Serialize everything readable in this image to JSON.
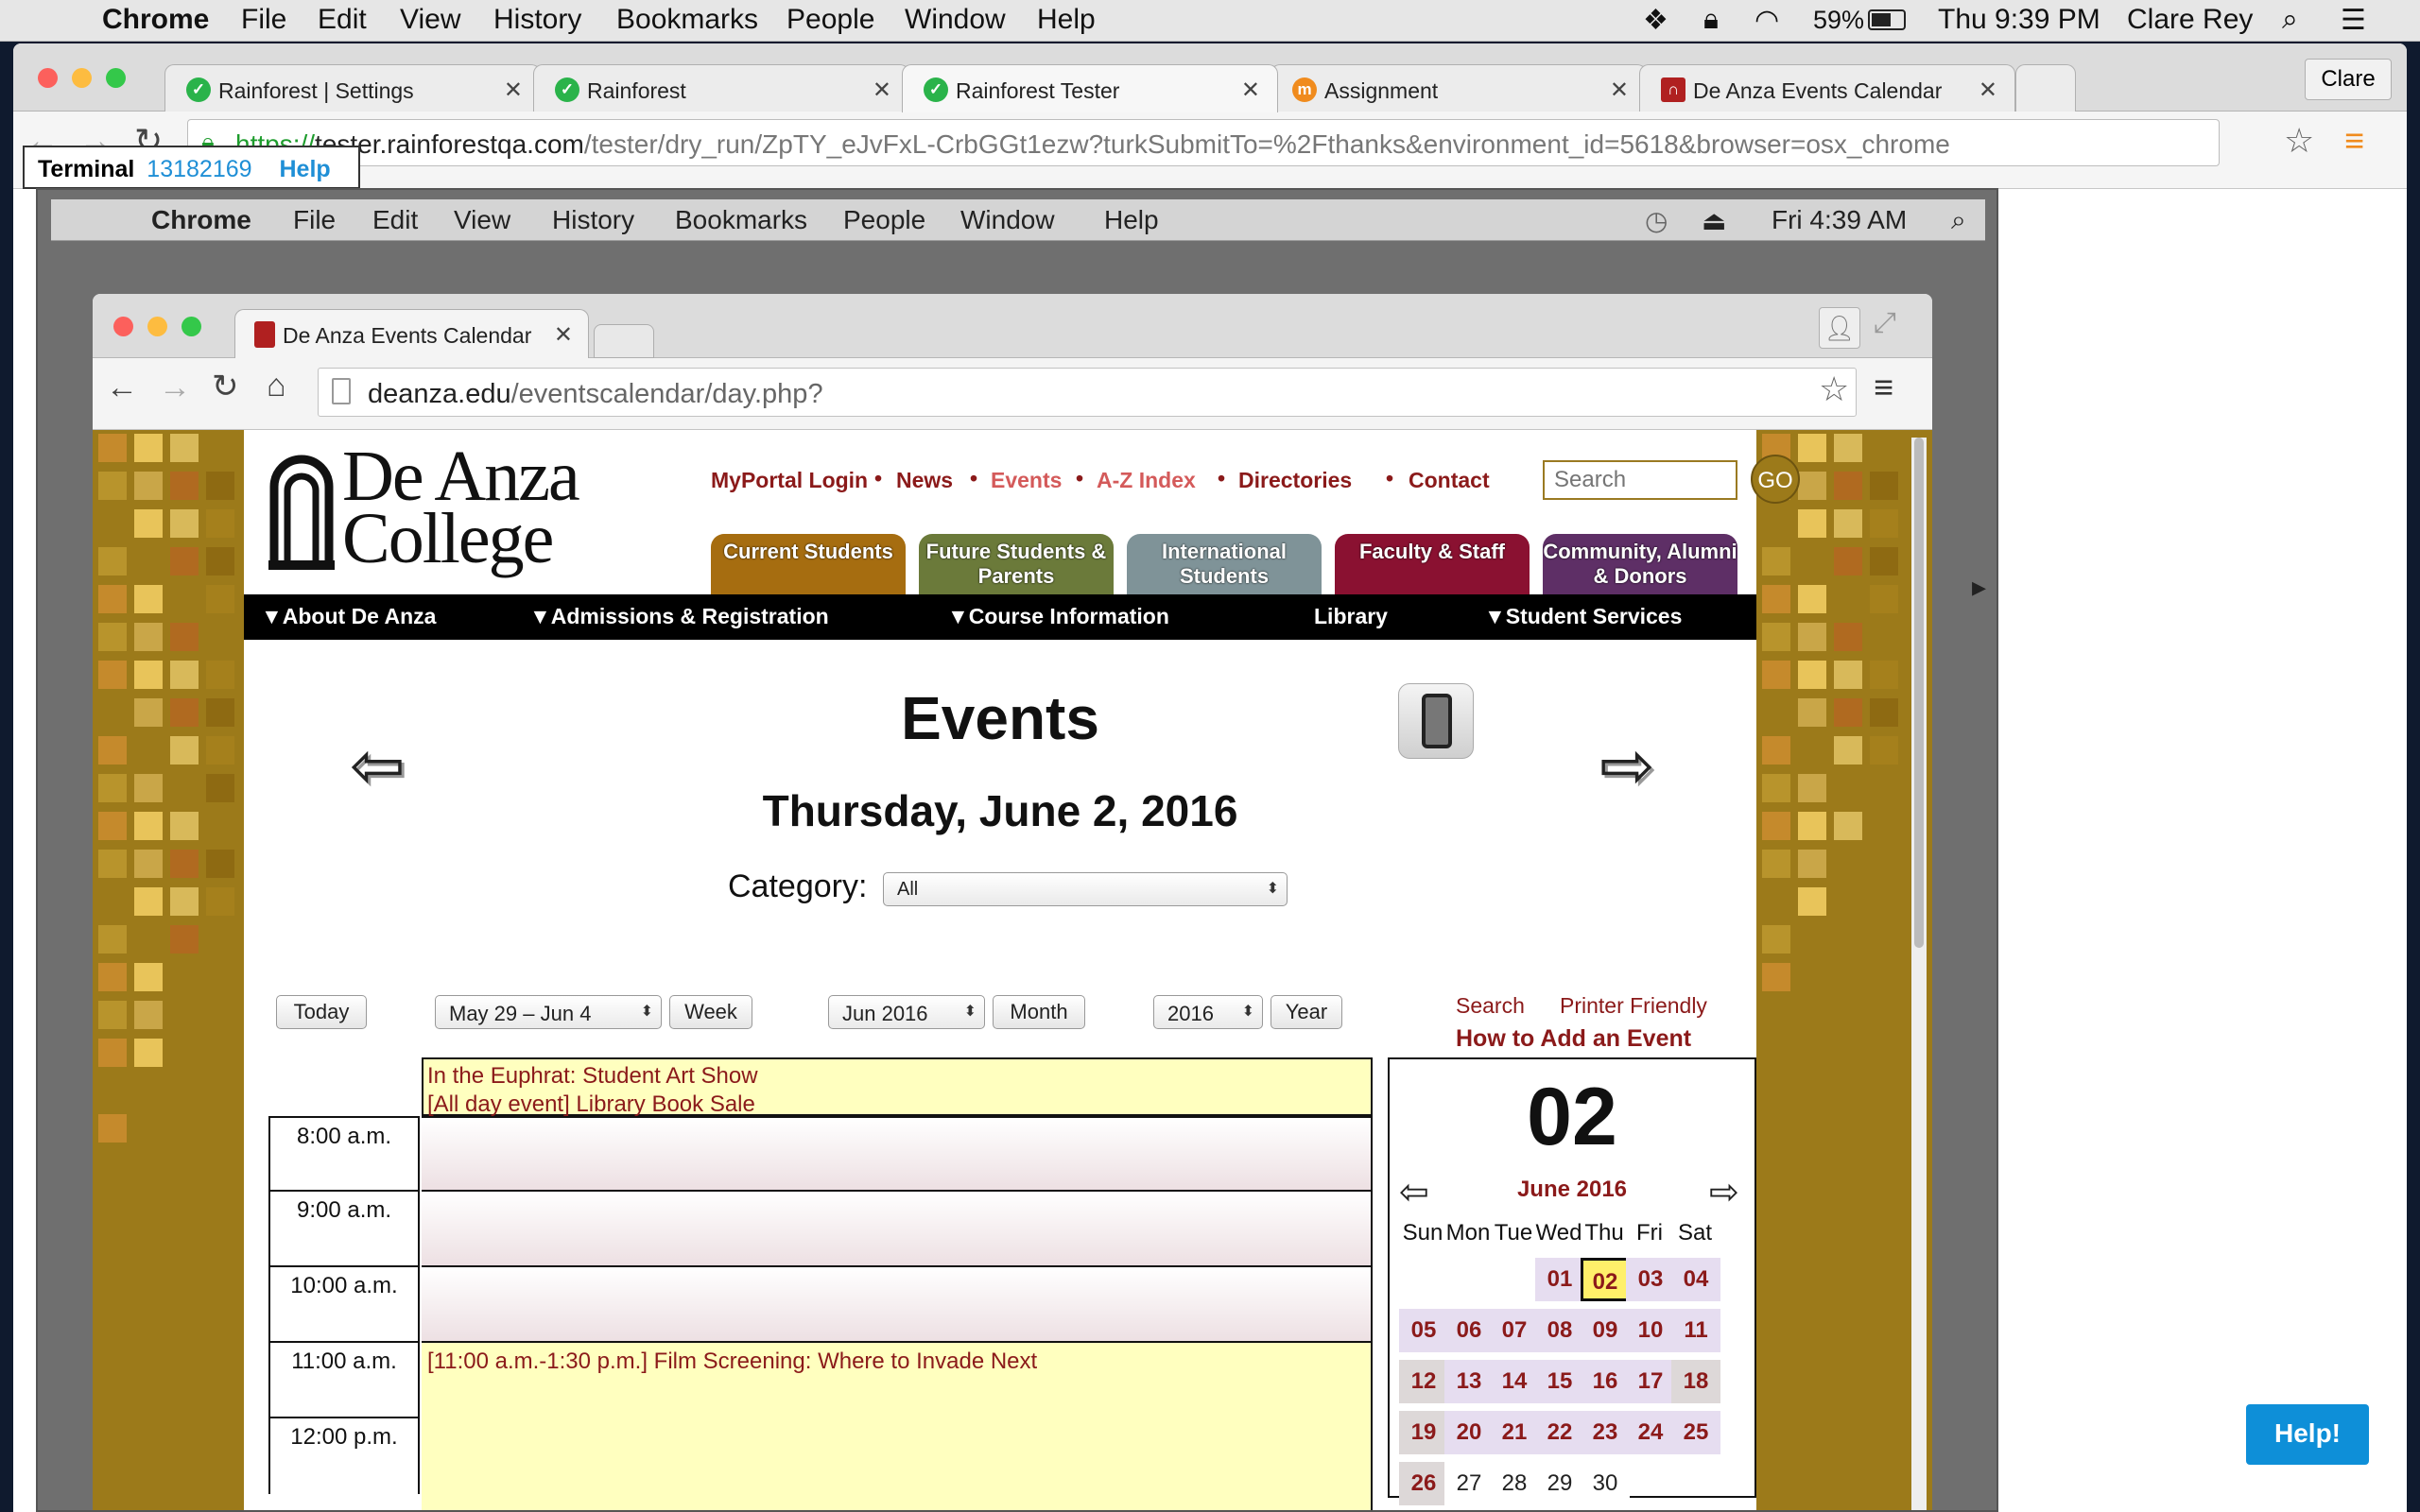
{
  "outer_menubar": {
    "app": "Chrome",
    "items": [
      "File",
      "Edit",
      "View",
      "History",
      "Bookmarks",
      "People",
      "Window",
      "Help"
    ],
    "battery": "59%",
    "clock": "Thu 9:39 PM",
    "user": "Clare Rey"
  },
  "outer_tabs": [
    {
      "label": "Rainforest | Settings"
    },
    {
      "label": "Rainforest"
    },
    {
      "label": "Rainforest Tester"
    },
    {
      "label": "Assignment"
    },
    {
      "label": "De Anza Events Calendar"
    }
  ],
  "outer_profile": "Clare",
  "outer_url": {
    "scheme": "https://",
    "host": "tester.rainforestqa.com",
    "path": "/tester/dry_run/ZpTY_eJvFxL-CrbGGt1ezw?turkSubmitTo=%2Fthanks&environment_id=5618&browser=osx_chrome"
  },
  "terminal": {
    "label": "Terminal",
    "id": "13182169",
    "help": "Help"
  },
  "inner_menubar": {
    "app": "Chrome",
    "items": [
      "File",
      "Edit",
      "View",
      "History",
      "Bookmarks",
      "People",
      "Window",
      "Help"
    ],
    "clock": "Fri 4:39 AM"
  },
  "inner_tab": {
    "label": "De Anza Events Calendar"
  },
  "inner_url": {
    "host": "deanza.edu",
    "path": "/eventscalendar/day.php?"
  },
  "site": {
    "logo_line1": "De Anza",
    "logo_line2": "College",
    "top_links": [
      "MyPortal Login",
      "News",
      "Events",
      "A-Z Index",
      "Directories",
      "Contact"
    ],
    "search_placeholder": "Search",
    "go_label": "GO",
    "audience_tabs": [
      {
        "label": "Current Students",
        "color": "#a66d10"
      },
      {
        "label": "Future Students & Parents",
        "color": "#6b7a3a"
      },
      {
        "label": "International Students",
        "color": "#7f9398"
      },
      {
        "label": "Faculty & Staff",
        "color": "#8a1131"
      },
      {
        "label": "Community, Alumni & Donors",
        "color": "#5e2f66"
      }
    ],
    "main_nav": [
      "▼About De Anza",
      "▼Admissions & Registration",
      "▼Course Information",
      "Library",
      "▼Student Services"
    ]
  },
  "events": {
    "heading": "Events",
    "date": "Thursday, June 2, 2016",
    "category_label": "Category:",
    "category_value": "All",
    "controls": {
      "today": "Today",
      "week_range": "May 29 – Jun 4",
      "week": "Week",
      "month_value": "Jun 2016",
      "month": "Month",
      "year_value": "2016",
      "year": "Year"
    },
    "links": {
      "search": "Search",
      "printer": "Printer Friendly",
      "add_event": "How to Add an Event"
    },
    "all_day": [
      "In the Euphrat: Student Art Show",
      "[All day event] Library Book Sale"
    ],
    "times": [
      "8:00 a.m.",
      "9:00 a.m.",
      "10:00 a.m.",
      "11:00 a.m.",
      "12:00 p.m."
    ],
    "timed_event": "[11:00 a.m.-1:30 p.m.] Film Screening: Where to Invade Next"
  },
  "mini_calendar": {
    "big_day": "02",
    "month_title": "June 2016",
    "weekdays": [
      "Sun",
      "Mon",
      "Tue",
      "Wed",
      "Thu",
      "Fri",
      "Sat"
    ],
    "weeks": [
      [
        "",
        "",
        "",
        "01",
        "02",
        "03",
        "04"
      ],
      [
        "05",
        "06",
        "07",
        "08",
        "09",
        "10",
        "11"
      ],
      [
        "12",
        "13",
        "14",
        "15",
        "16",
        "17",
        "18"
      ],
      [
        "19",
        "20",
        "21",
        "22",
        "23",
        "24",
        "25"
      ],
      [
        "26",
        "27",
        "28",
        "29",
        "30",
        "",
        ""
      ]
    ],
    "selected": "02"
  },
  "help_button": "Help!"
}
